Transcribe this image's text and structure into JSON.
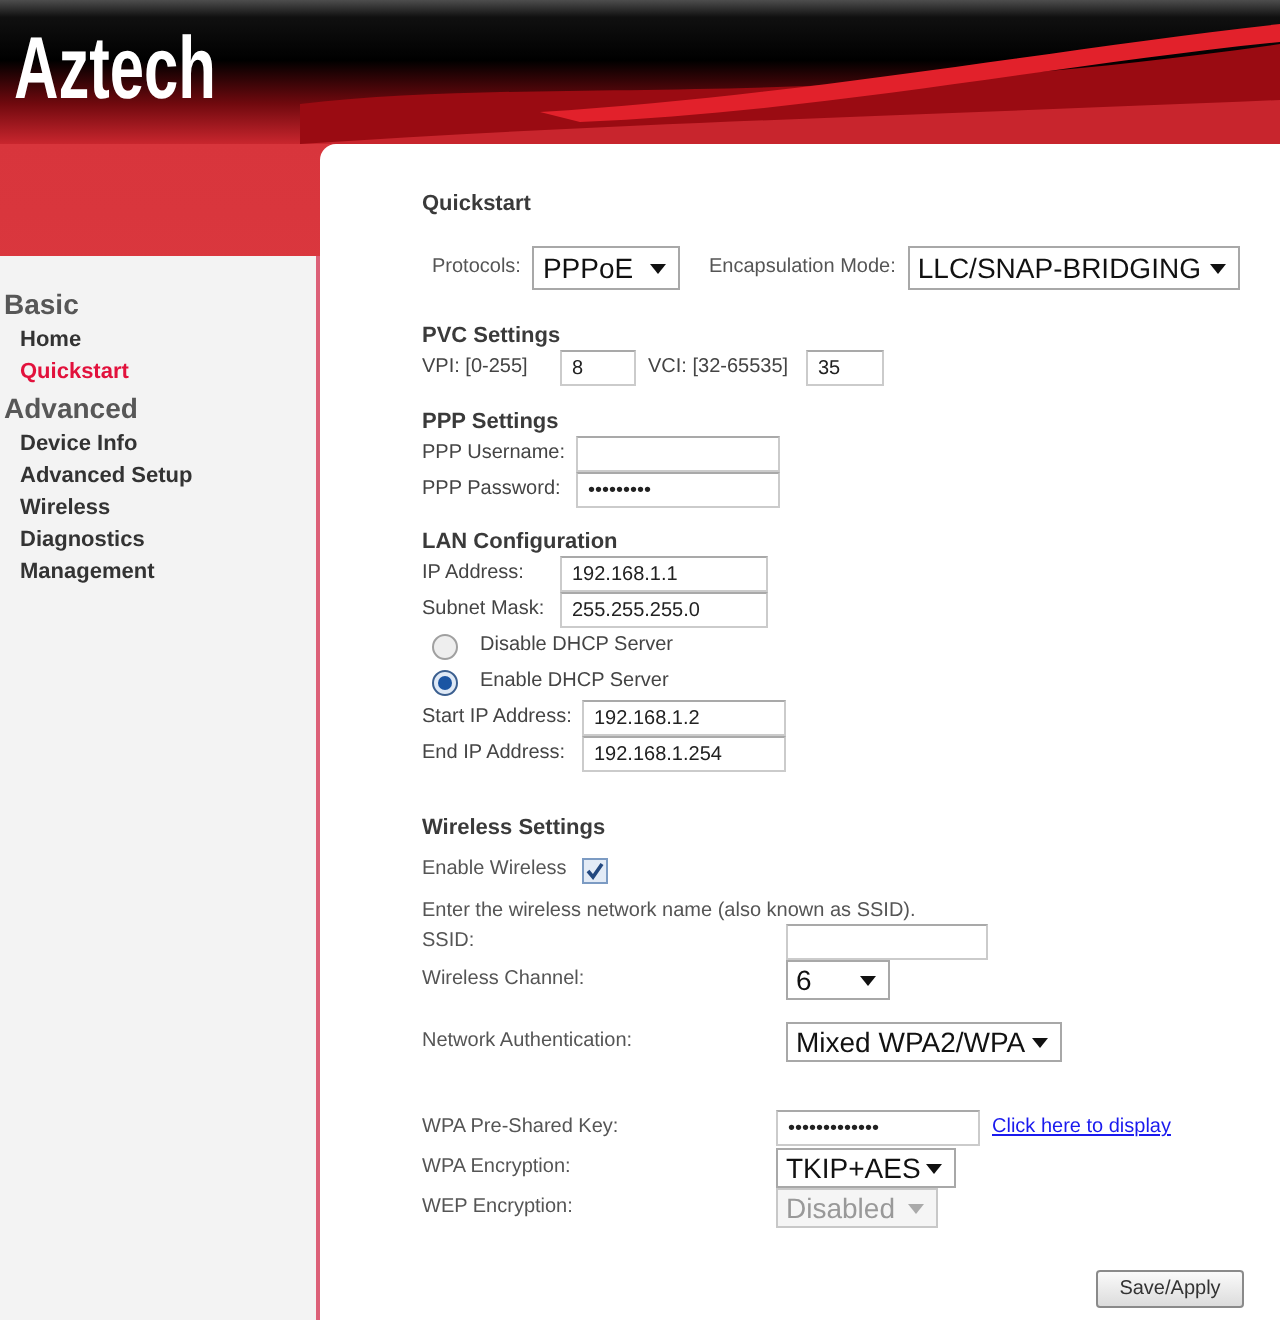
{
  "header": {
    "logo": "Aztech"
  },
  "sidebar": {
    "sections": [
      {
        "title": "Basic",
        "items": [
          {
            "label": "Home",
            "selected": false
          },
          {
            "label": "Quickstart",
            "selected": true
          }
        ]
      },
      {
        "title": "Advanced",
        "items": [
          {
            "label": "Device Info",
            "selected": false
          },
          {
            "label": "Advanced Setup",
            "selected": false
          },
          {
            "label": "Wireless",
            "selected": false
          },
          {
            "label": "Diagnostics",
            "selected": false
          },
          {
            "label": "Management",
            "selected": false
          }
        ]
      }
    ]
  },
  "page_title": "Quickstart",
  "connection": {
    "protocol": {
      "label": "Protocols:",
      "value": "PPPoE"
    },
    "encapsulation": {
      "label": "Encapsulation Mode:",
      "value": "LLC/SNAP-BRIDGING"
    }
  },
  "pvc_settings": {
    "title": "PVC Settings",
    "vpi": {
      "label": "VPI: [0-255]",
      "value": "8"
    },
    "vci": {
      "label": "VCI: [32-65535]",
      "value": "35"
    }
  },
  "ppp_settings": {
    "title": "PPP Settings",
    "username": {
      "label": "PPP Username:"
    },
    "password": {
      "label": "PPP Password:",
      "value": "•••••••••"
    }
  },
  "lan_configuration": {
    "title": "LAN Configuration",
    "ip_address": {
      "label": "IP Address:",
      "value": "192.168.1.1"
    },
    "subnet_mask": {
      "label": "Subnet Mask:",
      "value": "255.255.255.0"
    },
    "dhcp_options": [
      {
        "label": "Disable DHCP Server",
        "selected": false
      },
      {
        "label": "Enable DHCP Server",
        "selected": true
      }
    ],
    "start_ip": {
      "label": "Start IP Address:",
      "value": "192.168.1.2"
    },
    "end_ip": {
      "label": "End IP Address:",
      "value": "192.168.1.254"
    }
  },
  "wireless_settings": {
    "title": "Wireless Settings",
    "enable_wireless": {
      "label": "Enable Wireless",
      "checked": true
    },
    "ssid_hint": "Enter the wireless network name (also known as SSID).",
    "ssid": {
      "label": "SSID:"
    },
    "channel": {
      "label": "Wireless Channel:",
      "value": "6"
    },
    "authentication": {
      "label": "Network Authentication:",
      "value": "Mixed WPA2/WPA"
    },
    "pre_shared_key": {
      "label": "WPA Pre-Shared Key:",
      "value": "•••••••••••••",
      "link": "Click here to display"
    },
    "wpa_encryption": {
      "label": "WPA Encryption:",
      "value": "TKIP+AES"
    },
    "wep_encryption": {
      "label": "WEP Encryption:",
      "value": "Disabled",
      "disabled": true
    }
  },
  "save_button": "Save/Apply"
}
